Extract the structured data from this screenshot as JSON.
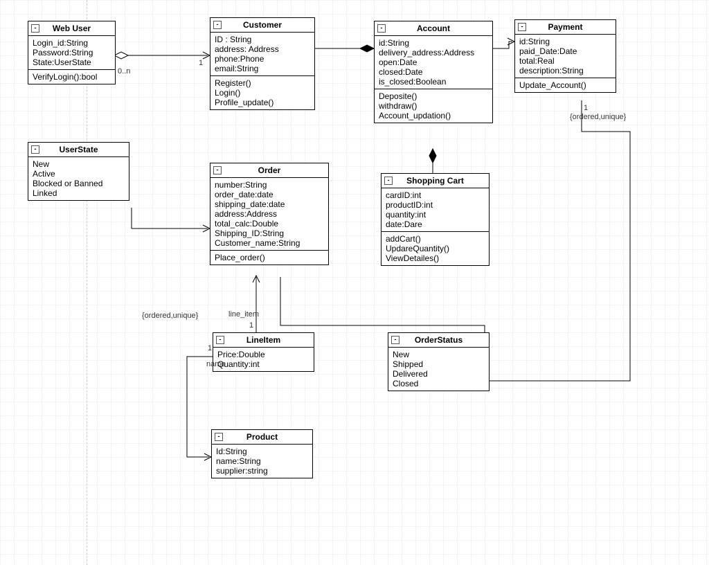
{
  "classes": {
    "webuser": {
      "title": "Web User",
      "attrs": [
        "Login_id:String",
        "Password:String",
        "State:UserState"
      ],
      "ops": [
        "VerifyLogin():bool"
      ]
    },
    "customer": {
      "title": "Customer",
      "attrs": [
        "ID : String",
        "address: Address",
        "phone:Phone",
        "email:String"
      ],
      "ops": [
        "Register()",
        "Login()",
        "Profile_update()"
      ]
    },
    "account": {
      "title": "Account",
      "attrs": [
        "id:String",
        "delivery_address:Address",
        "open:Date",
        "closed:Date",
        "is_closed:Boolean"
      ],
      "ops": [
        "Deposite()",
        "withdraw()",
        "Account_updation()"
      ]
    },
    "payment": {
      "title": "Payment",
      "attrs": [
        "id:String",
        "paid_Date:Date",
        "total:Real",
        "description:String"
      ],
      "ops": [
        "Update_Account()"
      ]
    },
    "userstate": {
      "title": "UserState",
      "attrs": [
        "New",
        "Active",
        "Blocked or Banned",
        "Linked"
      ]
    },
    "order": {
      "title": "Order",
      "attrs": [
        "number:String",
        "order_date:date",
        "shipping_date:date",
        "address:Address",
        "total_calc:Double",
        "Shipping_ID:String",
        "Customer_name:String"
      ],
      "ops": [
        "Place_order()"
      ]
    },
    "cart": {
      "title": "Shopping Cart",
      "attrs": [
        "cardID:int",
        "productID:int",
        "quantity:int",
        "date:Dare"
      ],
      "ops": [
        "addCart()",
        "UpdareQuantity()",
        "ViewDetailes()"
      ]
    },
    "lineitem": {
      "title": "LineItem",
      "attrs": [
        "Price:Double",
        "Quantity:int"
      ]
    },
    "orderstatus": {
      "title": "OrderStatus",
      "attrs": [
        "New",
        "Shipped",
        "Delivered",
        "Closed"
      ]
    },
    "product": {
      "title": "Product",
      "attrs": [
        "Id:String",
        "name:String",
        "supplier:string"
      ]
    }
  },
  "labels": {
    "webuser_mult": "0..n",
    "customer_mult": "1",
    "ordered_unique1": "{ordered,unique}",
    "ordered_unique2": "{ordered,unique}",
    "line_item": "line_item",
    "lineitem_mult_left": "1",
    "lineitem_mult_top": "1",
    "name": "name",
    "payment_mult": "1"
  }
}
